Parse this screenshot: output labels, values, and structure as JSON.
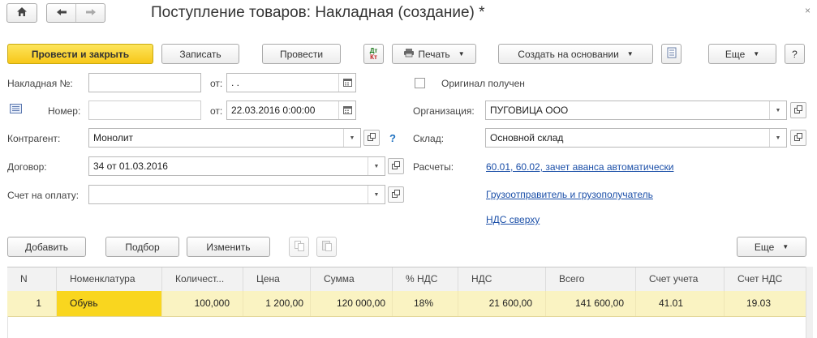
{
  "window": {
    "title": "Поступление товаров: Накладная (создание) *"
  },
  "icons": {
    "home": "home-icon",
    "back": "arrow-left-icon",
    "forward": "arrow-right-icon"
  },
  "toolbar": {
    "post_close": "Провести и закрыть",
    "save": "Записать",
    "post": "Провести",
    "dtkt_top": "Дт",
    "dtkt_bottom": "Кт",
    "print": "Печать",
    "create_based": "Создать на основании",
    "more": "Еще",
    "help": "?"
  },
  "form": {
    "invoice_label": "Накладная №:",
    "invoice_value": "",
    "from_label": "от:",
    "invoice_date": " .  .",
    "original_label": "Оригинал получен",
    "number_label": "Номер:",
    "number_value": "",
    "date_value": "22.03.2016  0:00:00",
    "org_label": "Организация:",
    "org_value": "ПУГОВИЦА ООО",
    "counterparty_label": "Контрагент:",
    "counterparty_value": "Монолит",
    "question": "?",
    "warehouse_label": "Склад:",
    "warehouse_value": "Основной склад",
    "contract_label": "Договор:",
    "contract_value": "34 от 01.03.2016",
    "settlements_label": "Расчеты:",
    "settlements_link": "60.01, 60.02, зачет аванса автоматически",
    "invoice_pay_label": "Счет на оплату:",
    "invoice_pay_value": "",
    "shipper_link": "Грузоотправитель и грузополучатель",
    "vat_link": "НДС сверху"
  },
  "table_toolbar": {
    "add": "Добавить",
    "pick": "Подбор",
    "change": "Изменить",
    "more": "Еще"
  },
  "table": {
    "headers": [
      "N",
      "Номенклатура",
      "Количест...",
      "Цена",
      "Сумма",
      "% НДС",
      "НДС",
      "Всего",
      "Счет учета",
      "Счет НДС"
    ],
    "rows": [
      [
        "1",
        "Обувь",
        "100,000",
        "1 200,00",
        "120 000,00",
        "18%",
        "21 600,00",
        "141 600,00",
        "41.01",
        "19.03"
      ]
    ]
  },
  "colors": {
    "accent": "#f7c719",
    "row_highlight": "#faf3c2",
    "link": "#1b4fa8"
  }
}
